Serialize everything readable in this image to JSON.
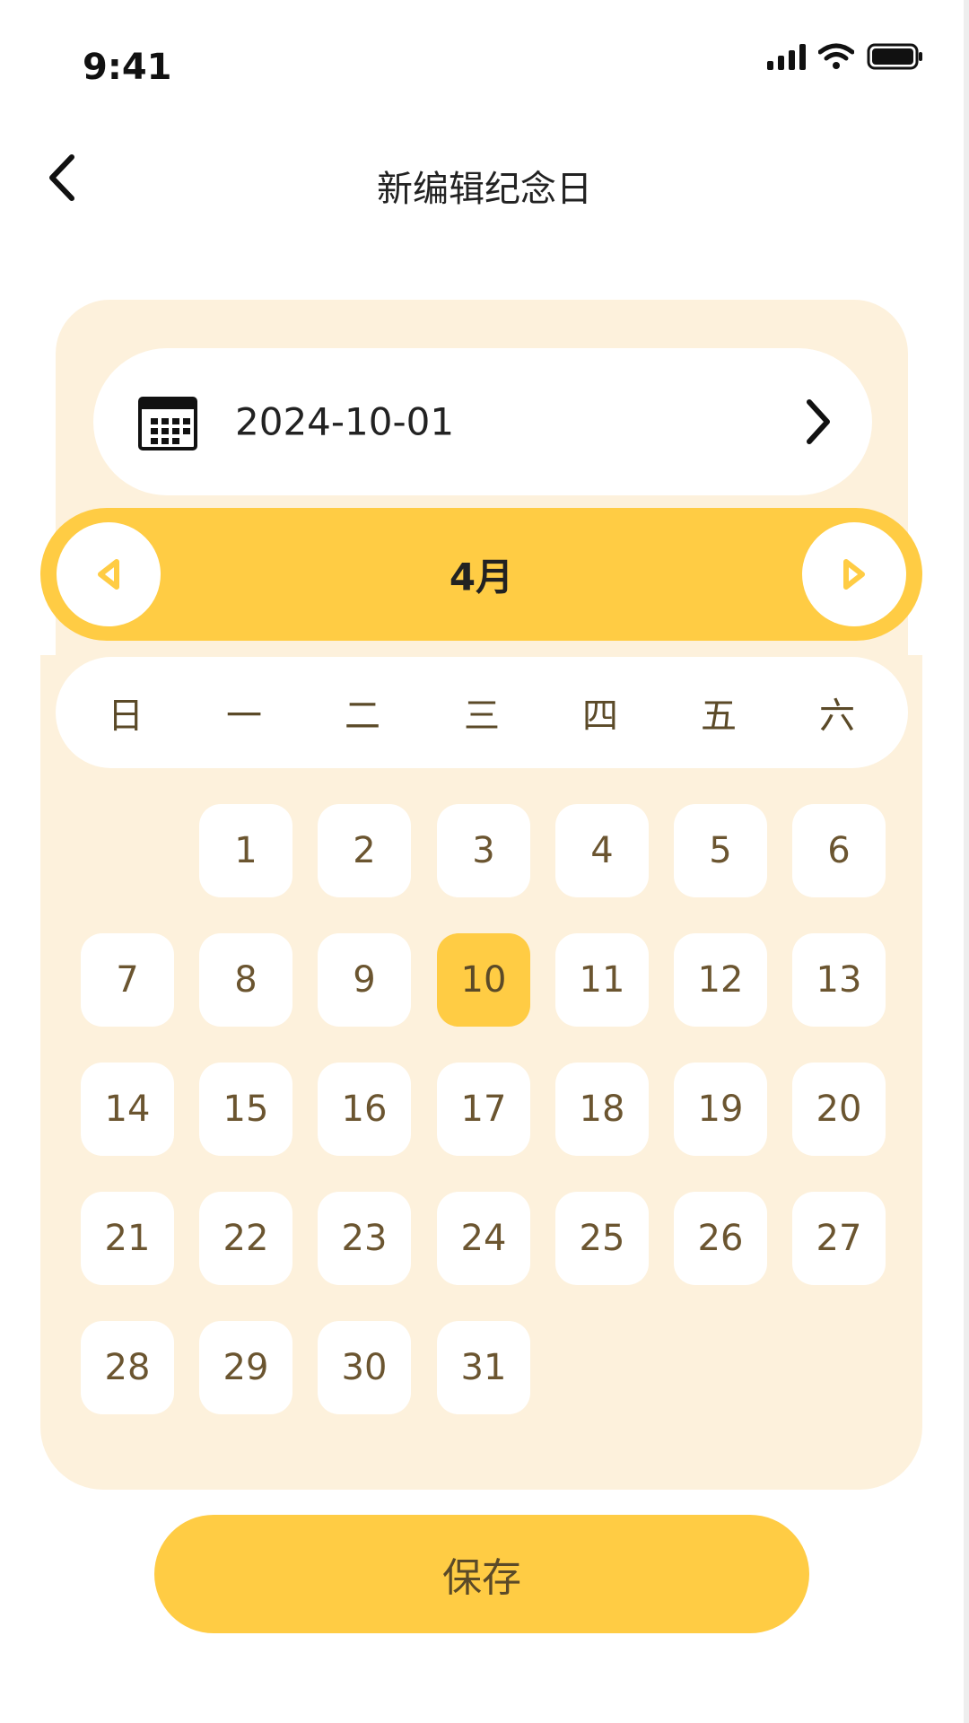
{
  "status_bar": {
    "time": "9:41"
  },
  "header": {
    "title": "新编辑纪念日",
    "back_icon": "chevron-left-icon"
  },
  "date_field": {
    "value": "2024-10-01",
    "icon": "calendar-icon",
    "arrow_icon": "chevron-right-icon"
  },
  "calendar": {
    "month_label": "4月",
    "prev_icon": "triangle-left-icon",
    "next_icon": "triangle-right-icon",
    "weekdays": [
      "日",
      "一",
      "二",
      "三",
      "四",
      "五",
      "六"
    ],
    "first_weekday_index": 1,
    "days": [
      "1",
      "2",
      "3",
      "4",
      "5",
      "6",
      "7",
      "8",
      "9",
      "10",
      "11",
      "12",
      "13",
      "14",
      "15",
      "16",
      "17",
      "18",
      "19",
      "20",
      "21",
      "22",
      "23",
      "24",
      "25",
      "26",
      "27",
      "28",
      "29",
      "30",
      "31"
    ],
    "selected_day": "10"
  },
  "colors": {
    "accent": "#ffcc44",
    "panel": "#fdf1dc",
    "day_text": "#6b5530"
  },
  "save_button": {
    "label": "保存"
  }
}
